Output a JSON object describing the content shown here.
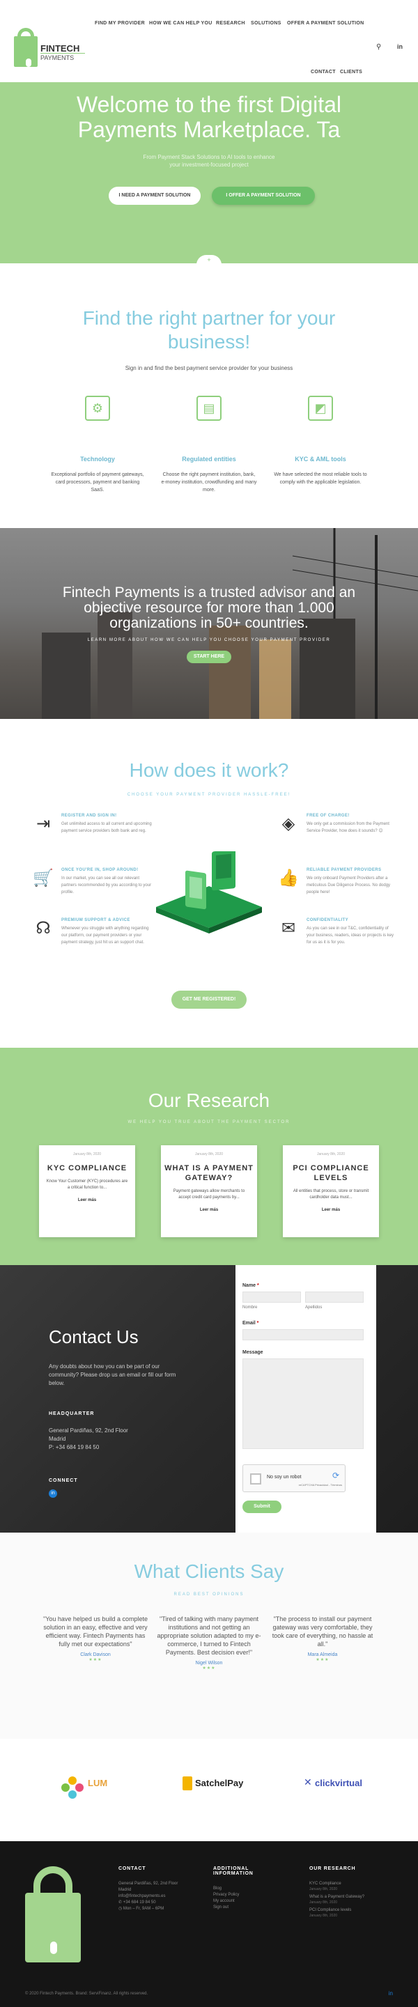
{
  "logo": {
    "name": "FINTECH",
    "sub": "PAYMENTS"
  },
  "nav": {
    "items": [
      "FIND MY PROVIDER",
      "HOW WE CAN HELP YOU",
      "RESEARCH",
      "SOLUTIONS",
      "OFFER A PAYMENT SOLUTION",
      "CONTACT",
      "CLIENTS"
    ],
    "search_icon": "search-icon",
    "linkedin_icon": "linkedin-icon"
  },
  "hero": {
    "title": "Welcome to the first Digital Payments Marketplace. Ta",
    "subtitle": "From Payment Stack Solutions to AI tools to enhance your investment-focused project",
    "btn_need": "I NEED A PAYMENT SOLUTION",
    "btn_offer": "I OFFER A PAYMENT SOLUTION",
    "scroll_icon": "+"
  },
  "partner": {
    "title": "Find the right partner for your business!",
    "subtitle": "Sign in and find the best payment service provider for your business",
    "features": [
      {
        "icon": "technology-icon",
        "glyph": "⚙",
        "title": "Technology",
        "text": "Exceptional portfolio of payment gateways, card processors, payment and banking SaaS."
      },
      {
        "icon": "regulated-entities-icon",
        "glyph": "▤",
        "title": "Regulated entities",
        "text": "Choose the right payment institution, bank, e-money institution, crowdfunding and many more."
      },
      {
        "icon": "kyc-aml-icon",
        "glyph": "◩",
        "title": "KYC & AML tools",
        "text": "We have selected the most reliable tools to comply with the applicable legislation."
      }
    ]
  },
  "trusted": {
    "title": "Fintech Payments is a trusted advisor and an objective resource for more than 1.000 organizations in 50+ countries.",
    "subtitle": "LEARN MORE ABOUT HOW WE CAN HELP YOU CHOOSE YOUR PAYMENT PROVIDER",
    "btn": "START HERE"
  },
  "how": {
    "title": "How does it work?",
    "subtitle": "CHOOSE YOUR PAYMENT PROVIDER HASSLE-FREE!",
    "steps_left": [
      {
        "icon": "login-icon",
        "glyph": "⇥",
        "title": "REGISTER AND SIGN IN!",
        "text": "Get unlimited access to all current and upcoming payment service providers both bank and reg."
      },
      {
        "icon": "cart-icon",
        "glyph": "🛒",
        "title": "ONCE YOU'RE IN, SHOP AROUND!",
        "text": "In our market, you can see all our relevant partners recommended by you according to your profile."
      },
      {
        "icon": "support-icon",
        "glyph": "☊",
        "title": "PREMIUM SUPPORT & ADVICE",
        "text": "Whenever you struggle with anything regarding our platform, our payment providers or your payment strategy, just hit us an support chat."
      }
    ],
    "steps_right": [
      {
        "icon": "free-tag-icon",
        "glyph": "◈",
        "title": "FREE OF CHARGE!",
        "text": "We only get a commission from the Payment Service Provider, how does it sounds? 😊"
      },
      {
        "icon": "thumbs-up-icon",
        "glyph": "👍",
        "title": "RELIABLE PAYMENT PROVIDERS",
        "text": "We only onboard Payment Providers after a meticulous Due Diligence Process. No dodgy people here!"
      },
      {
        "icon": "mail-icon",
        "glyph": "✉",
        "title": "CONFIDENTIALITY",
        "text": "As you can see in our T&C, confidentiality of your business, readers, ideas or projects is key for us as it is for you."
      }
    ],
    "btn": "GET ME REGISTERED!"
  },
  "research": {
    "title": "Our Research",
    "subtitle": "WE HELP YOU TRUE ABOUT THE PAYMENT SECTOR",
    "cards": [
      {
        "date": "January 8th, 2020",
        "title": "KYC COMPLIANCE",
        "text": "Know Your Customer (KYC) procedures are a critical function to...",
        "more": "Leer más"
      },
      {
        "date": "January 8th, 2020",
        "title": "WHAT IS A PAYMENT GATEWAY?",
        "text": "Payment gateways allow merchants to accept credit card payments by...",
        "more": "Leer más"
      },
      {
        "date": "January 8th, 2020",
        "title": "PCI COMPLIANCE LEVELS",
        "text": "All entities that process, store or transmit cardholder data must...",
        "more": "Leer más"
      }
    ]
  },
  "contact": {
    "title": "Contact Us",
    "intro": "Any doubts about how you can be part of our community? Please drop us an email or fill our form below.",
    "hq_label": "HEADQUARTER",
    "address": [
      "General Pardiñas, 92, 2nd Floor",
      "Madrid",
      "P: +34 684 19 84 50"
    ],
    "connect_label": "CONNECT",
    "form": {
      "name_label": "Name",
      "first_hint": "Nombre",
      "last_hint": "Apellidos",
      "email_label": "Email",
      "message_label": "Message",
      "captcha_text": "No soy un robot",
      "captcha_brand": "reCAPTCHA Privacidad - Términos",
      "submit": "Submit"
    }
  },
  "clients": {
    "title": "What Clients Say",
    "subtitle": "READ BEST OPINIONS",
    "quotes": [
      {
        "text": "\"You have helped us build a complete solution in an easy, effective and very efficient way. Fintech Payments has fully met our expectations\"",
        "author": "Clark Davison",
        "stars": "★★★"
      },
      {
        "text": "\"Tired of talking with many payment institutions and not getting an appropriate solution adapted to my e-commerce, I turned to Fintech Payments. Best decision ever!\"",
        "author": "Nigel Wilson",
        "stars": "★★★"
      },
      {
        "text": "\"The process to install our payment gateway was very comfortable, they took care of everything, no hassle at all.\"",
        "author": "Mara Almeida",
        "stars": "★★★"
      }
    ]
  },
  "partners": [
    "LUM",
    "SatchelPay",
    "clickvirtual"
  ],
  "footer": {
    "contact_h": "CONTACT",
    "contact_lines": [
      "General Pardiñas, 92, 2nd Floor",
      "Madrid",
      "info@fintechpayments.es",
      "✆ +34 684 19 84 50",
      "◷ Mon – Fr, 9AM – 6PM"
    ],
    "info_h": "ADDITIONAL INFORMATION",
    "info_lines": [
      "Blog",
      "Privacy Policy",
      "My account",
      "Sign out"
    ],
    "research_h": "OUR RESEARCH",
    "research_items": [
      {
        "title": "KYC Compliance",
        "date": "January 8th, 2020"
      },
      {
        "title": "What is a Payment Gateway?",
        "date": "January 8th, 2020"
      },
      {
        "title": "PCI Compliance levels",
        "date": "January 8th, 2020"
      }
    ],
    "copyright": "© 2020 Fintech Payments. Brand: ServiFinanz. All rights reserved.",
    "linkedin": "in"
  },
  "colors": {
    "green": "#a3d58e",
    "blue": "#86ccdf",
    "dark": "#151515"
  }
}
